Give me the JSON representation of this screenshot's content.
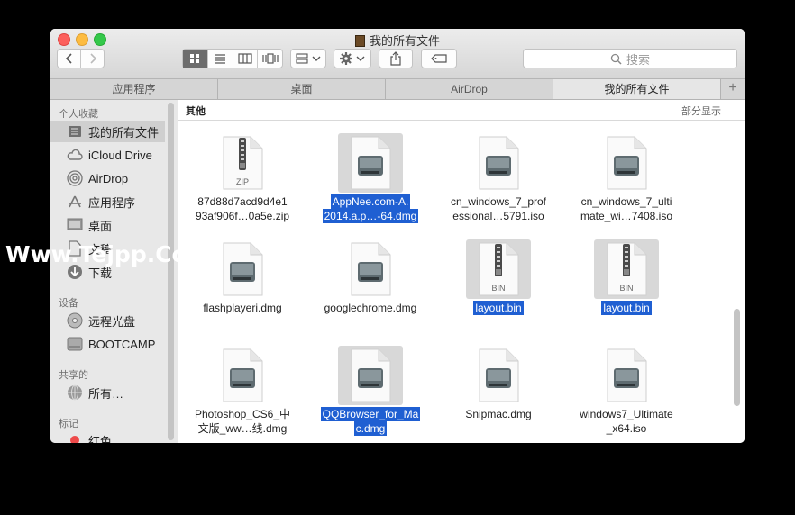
{
  "window": {
    "title": "我的所有文件"
  },
  "toolbar": {
    "view_icons": [
      "icon-view-icon",
      "list-view-icon",
      "column-view-icon",
      "coverflow-view-icon"
    ],
    "search_placeholder": "搜索"
  },
  "tabs": [
    {
      "label": "应用程序",
      "active": false
    },
    {
      "label": "桌面",
      "active": false
    },
    {
      "label": "AirDrop",
      "active": false
    },
    {
      "label": "我的所有文件",
      "active": true
    }
  ],
  "sidebar": {
    "sections": [
      {
        "heading": "个人收藏",
        "items": [
          {
            "label": "我的所有文件",
            "icon": "all-files-icon",
            "selected": true
          },
          {
            "label": "iCloud Drive",
            "icon": "cloud-icon"
          },
          {
            "label": "AirDrop",
            "icon": "airdrop-icon"
          },
          {
            "label": "应用程序",
            "icon": "applications-icon"
          },
          {
            "label": "桌面",
            "icon": "desktop-icon"
          },
          {
            "label": "文稿",
            "icon": "documents-icon"
          },
          {
            "label": "下载",
            "icon": "downloads-icon"
          }
        ]
      },
      {
        "heading": "设备",
        "items": [
          {
            "label": "远程光盘",
            "icon": "disc-icon"
          },
          {
            "label": "BOOTCAMP",
            "icon": "drive-icon"
          }
        ]
      },
      {
        "heading": "共享的",
        "items": [
          {
            "label": "所有…",
            "icon": "network-icon"
          }
        ]
      },
      {
        "heading": "标记",
        "items": [
          {
            "label": "红色",
            "icon": "red-tag-icon"
          }
        ]
      }
    ]
  },
  "content": {
    "section_title": "其他",
    "show_partial": "部分显示",
    "files": [
      {
        "lines": [
          "87d88d7acd9d4e1",
          "93af906f…0a5e.zip"
        ],
        "kind": "zip",
        "badge": "ZIP",
        "selected": false
      },
      {
        "lines": [
          "AppNee.com-A.",
          "2014.a.p…-64.dmg"
        ],
        "kind": "dmg",
        "selected": true
      },
      {
        "lines": [
          "cn_windows_7_prof",
          "essional…5791.iso"
        ],
        "kind": "dmg",
        "selected": false
      },
      {
        "lines": [
          "cn_windows_7_ulti",
          "mate_wi…7408.iso"
        ],
        "kind": "dmg",
        "selected": false
      },
      {
        "lines": [
          "flashplayeri.dmg"
        ],
        "kind": "dmg",
        "selected": false
      },
      {
        "lines": [
          "googlechrome.dmg"
        ],
        "kind": "dmg",
        "selected": false
      },
      {
        "lines": [
          "layout.bin"
        ],
        "kind": "zip",
        "badge": "BIN",
        "selected": true
      },
      {
        "lines": [
          "layout.bin"
        ],
        "kind": "zip",
        "badge": "BIN",
        "selected": true
      },
      {
        "lines": [
          "Photoshop_CS6_中",
          "文版_ww…线.dmg"
        ],
        "kind": "dmg",
        "selected": false
      },
      {
        "lines": [
          "QQBrowser_for_Ma",
          "c.dmg"
        ],
        "kind": "dmg",
        "selected": true
      },
      {
        "lines": [
          "Snipmac.dmg"
        ],
        "kind": "dmg",
        "selected": false
      },
      {
        "lines": [
          "windows7_Ultimate",
          "_x64.iso"
        ],
        "kind": "dmg",
        "selected": false
      }
    ]
  },
  "watermark": "Www.Tejpp.Com"
}
